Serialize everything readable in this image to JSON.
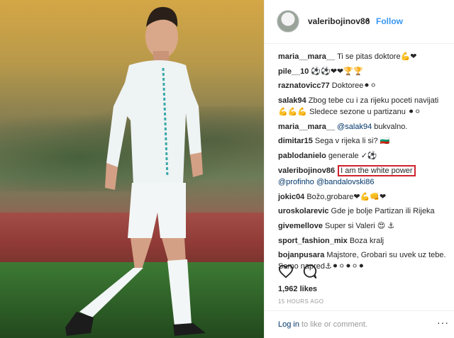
{
  "post": {
    "username": "valeribojinov86",
    "separator": "•",
    "follow_label": "Follow",
    "likes": "1,962 likes",
    "timestamp": "15 HOURS AGO",
    "login_link": "Log in",
    "login_rest": " to like or comment.",
    "more_label": "···"
  },
  "comments": [
    {
      "user": "maria__mara__",
      "text": "Ti se pitas doktore💪❤"
    },
    {
      "user": "pile__10",
      "text": "⚽⚽❤❤🏆🏆"
    },
    {
      "user": "raznatovicc77",
      "text": "Doktoree⚫⚪"
    },
    {
      "user": "salak94",
      "text": "Zbog tebe cu i za rijeku poceti navijati 💪💪💪 Sledece sezone u partizanu ⚫⚪"
    },
    {
      "user": "maria__mara__",
      "mention": "@salak94",
      "text": " bukvalno."
    },
    {
      "user": "dimitar15",
      "text": "Sega v rijeka li si? 🇧🇬"
    },
    {
      "user": "pablodanielo",
      "text": "generale ✓⚽"
    },
    {
      "user": "valeribojinov86",
      "highlight": "I am the white power",
      "mention2": "@profinho @bandalovski86"
    },
    {
      "user": "jokic04",
      "text": "Božo,grobare❤💪👊❤"
    },
    {
      "user": "uroskolarevic",
      "text": "Gde je bolje Partizan ili Rijeka"
    },
    {
      "user": "givemellove",
      "text": "Super si Valeri 😍 ⚓"
    },
    {
      "user": "sport_fashion_mix",
      "text": "Boza kralj"
    },
    {
      "user": "bojanpusara",
      "text": "Majstore, Grobari su uvek uz tebe. Samo napred⚓⚫⚪⚫⚪⚫"
    }
  ],
  "icons": {
    "like": "heart-outline-icon",
    "comment": "speech-bubble-icon"
  }
}
